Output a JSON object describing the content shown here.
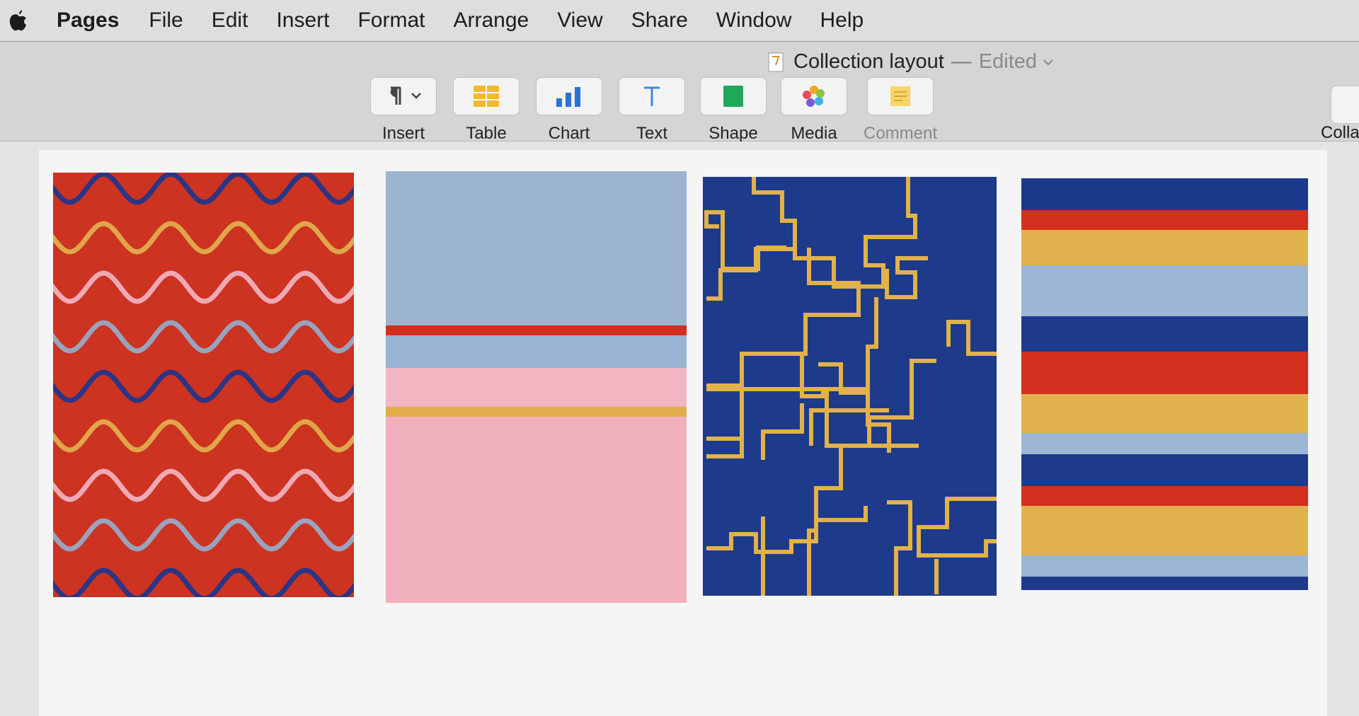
{
  "menubar": {
    "app_name": "Pages",
    "items": [
      "File",
      "Edit",
      "Insert",
      "Format",
      "Arrange",
      "View",
      "Share",
      "Window",
      "Help"
    ]
  },
  "document": {
    "name": "Collection layout",
    "separator": "—",
    "status": "Edited"
  },
  "toolbar": {
    "insert_label": "Insert",
    "table_label": "Table",
    "chart_label": "Chart",
    "text_label": "Text",
    "shape_label": "Shape",
    "media_label": "Media",
    "comment_label": "Comment",
    "collapse_label": "Colla"
  },
  "colors": {
    "red": "#cc3320",
    "navy": "#1e3a8a",
    "gold": "#e2b24a",
    "pink": "#eeb0bc",
    "sky": "#9cb4cf",
    "light_pink": "#f0a9b4"
  },
  "icons": {
    "apple": "apple-icon",
    "insert": "paragraph-icon",
    "table": "table-icon",
    "chart": "bar-chart-icon",
    "text": "text-icon",
    "shape": "shape-icon",
    "media": "photos-icon",
    "comment": "comment-icon"
  }
}
